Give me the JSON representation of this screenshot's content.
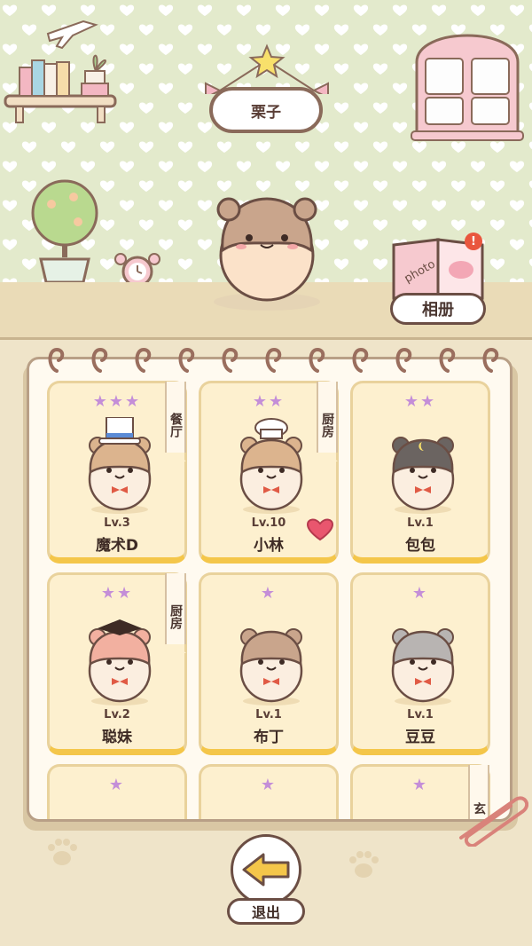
{
  "room": {
    "hamster_name": "栗子",
    "album_label": "相册",
    "album_badge": "!"
  },
  "cards": [
    {
      "stars": "★★★",
      "level": "Lv.3",
      "name": "魔术D",
      "room_tag": "餐厅",
      "fur": "#dcb48e",
      "accessory": "top-hat",
      "liked": false
    },
    {
      "stars": "★★",
      "level": "Lv.10",
      "name": "小林",
      "room_tag": "厨房",
      "fur": "#dcb48e",
      "accessory": "chef-hat",
      "liked": true
    },
    {
      "stars": "★★",
      "level": "Lv.1",
      "name": "包包",
      "room_tag": "",
      "fur": "#6b6461",
      "accessory": "moon",
      "liked": false
    },
    {
      "stars": "★★",
      "level": "Lv.2",
      "name": "聪妹",
      "room_tag": "厨房",
      "fur": "#f2b0a0",
      "accessory": "grad-cap",
      "liked": false
    },
    {
      "stars": "★",
      "level": "Lv.1",
      "name": "布丁",
      "room_tag": "",
      "fur": "#c9a58c",
      "accessory": "",
      "liked": false
    },
    {
      "stars": "★",
      "level": "Lv.1",
      "name": "豆豆",
      "room_tag": "",
      "fur": "#b8b4b2",
      "accessory": "",
      "liked": false
    },
    {
      "stars": "★",
      "level": "",
      "name": "",
      "room_tag": "",
      "fur": "",
      "accessory": "",
      "liked": false
    },
    {
      "stars": "★",
      "level": "",
      "name": "",
      "room_tag": "",
      "fur": "",
      "accessory": "",
      "liked": false
    },
    {
      "stars": "★",
      "level": "",
      "name": "",
      "room_tag": "玄",
      "fur": "",
      "accessory": "",
      "liked": false
    }
  ],
  "footer": {
    "exit_label": "退出"
  },
  "colors": {
    "wall": "#e3eacc",
    "heart_pattern": "#ffffff",
    "card_bg": "#fdf0cf",
    "card_bottom": "#f4c64a",
    "star": "#c48ed8",
    "like_heart": "#e9566e"
  }
}
